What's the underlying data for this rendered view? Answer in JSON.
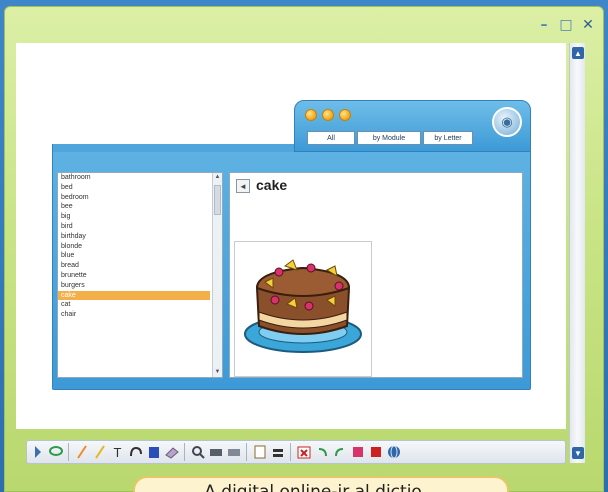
{
  "window": {
    "minimize": "–",
    "maximize": "□",
    "close": "✕"
  },
  "dictionary": {
    "tabs": [
      "All",
      "by Module",
      "by Letter"
    ],
    "words": [
      "bathroom",
      "bed",
      "bedroom",
      "bee",
      "big",
      "bird",
      "birthday",
      "blonde",
      "blue",
      "bread",
      "brunette",
      "burgers",
      "cake",
      "cat",
      "chair"
    ],
    "selected_index": 12,
    "selected_word": "cake",
    "list_scroll_up": "▲",
    "list_scroll_down": "▼",
    "speaker_glyph": "◄"
  },
  "toolbar": {
    "icons": [
      "arrow-icon",
      "lasso-icon",
      "pen-orange-icon",
      "pen-yellow-icon",
      "text-icon",
      "connector-icon",
      "fill-icon",
      "eraser-icon",
      "zoom-icon",
      "spotlight-icon",
      "reveal-icon",
      "page-icon",
      "keyboard-icon",
      "clear-icon",
      "undo-icon",
      "redo-icon",
      "flag-icon",
      "flag-red-icon",
      "globe-icon"
    ],
    "text_tool": "T"
  },
  "caption": {
    "text": "A digital online-ir al dictio..."
  },
  "colors": {
    "frame_green": "#c9e486",
    "dict_blue": "#3d9ad6",
    "selection_orange": "#f3b04a",
    "cake_brown": "#8a4f2b",
    "plate_blue": "#3aa7d8"
  }
}
